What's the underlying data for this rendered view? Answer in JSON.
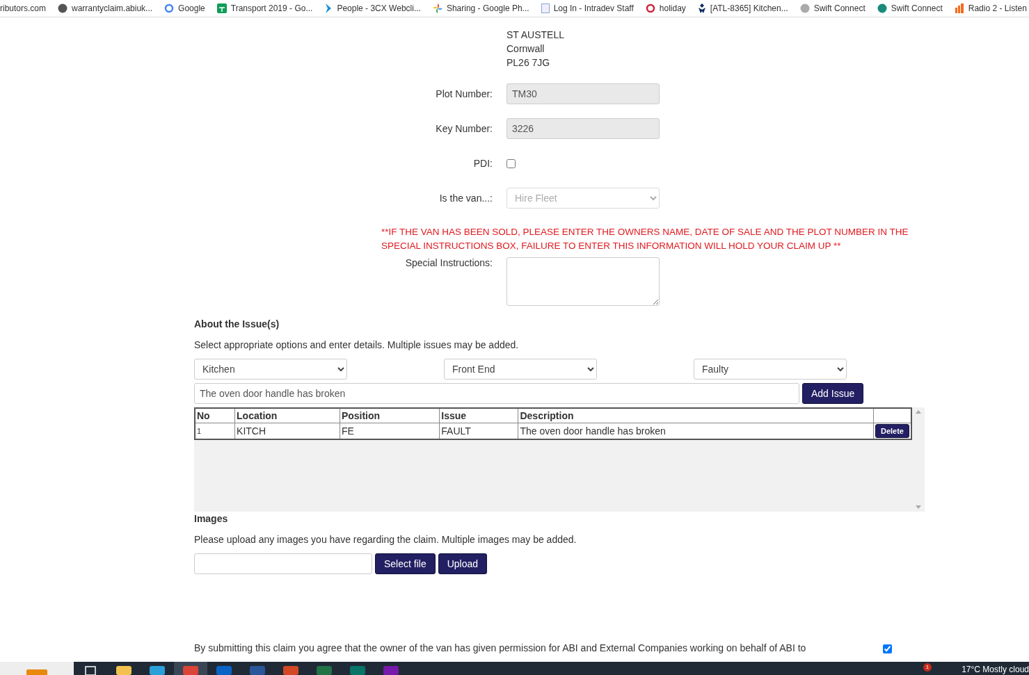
{
  "bookmarks": [
    {
      "kind": "none",
      "label": "ributors.com"
    },
    {
      "kind": "globe",
      "label": "warrantyclaim.abiuk..."
    },
    {
      "kind": "google",
      "label": "Google"
    },
    {
      "kind": "sheet",
      "label": "Transport 2019 - Go..."
    },
    {
      "kind": "chevron",
      "label": "People - 3CX Webcli..."
    },
    {
      "kind": "pinwheel",
      "label": "Sharing - Google Ph..."
    },
    {
      "kind": "doc",
      "label": "Log In - Intradev Staff"
    },
    {
      "kind": "ring",
      "label": "holiday"
    },
    {
      "kind": "figure",
      "label": "[ATL-8365] Kitchen..."
    },
    {
      "kind": "sphere",
      "label": "Swift Connect"
    },
    {
      "kind": "globe-teal",
      "label": "Swift Connect"
    },
    {
      "kind": "bars",
      "label": "Radio 2 - Listen"
    }
  ],
  "address": [
    "ST AUSTELL",
    "Cornwall",
    "PL26 7JG"
  ],
  "fields": [
    {
      "kind": "text",
      "label": "Plot Number:",
      "value": "TM30",
      "disabled": true
    },
    {
      "kind": "text",
      "label": "Key Number:",
      "value": "3226",
      "disabled": true
    },
    {
      "kind": "checkbox",
      "label": "PDI:",
      "checked": false
    },
    {
      "kind": "select",
      "label": "Is the van...:",
      "value": "Hire Fleet",
      "disabled": true
    }
  ],
  "warning": "**IF THE VAN HAS BEEN SOLD, PLEASE ENTER THE OWNERS NAME, DATE OF SALE AND THE PLOT NUMBER IN THE SPECIAL INSTRUCTIONS BOX, FAILURE TO ENTER THIS INFORMATION WILL HOLD YOUR CLAIM UP **",
  "special_instructions": {
    "label": "Special Instructions:"
  },
  "issues": {
    "heading": "About the Issue(s)",
    "text": "Select appropriate options and enter details. Multiple issues may be added.",
    "selects": [
      "Kitchen",
      "Front End",
      "Faulty"
    ],
    "description": "The oven door handle has broken",
    "add_button": "Add Issue",
    "table": {
      "columns": [
        "No",
        "Location",
        "Position",
        "Issue",
        "Description"
      ],
      "rows": [
        {
          "cells": [
            "1",
            "KITCH",
            "FE",
            "FAULT",
            "The oven door handle has broken"
          ],
          "action": "Delete"
        }
      ]
    }
  },
  "images": {
    "heading": "Images",
    "text": "Please upload any images you have regarding the claim. Multiple images may be added.",
    "select_button": "Select file",
    "upload_button": "Upload"
  },
  "consent": {
    "text": "By submitting this claim you agree that the owner of the van has given permission for ABI and External Companies working on behalf of ABI to",
    "checked": true
  },
  "taskbar": {
    "apps": [
      {
        "kind": "folder",
        "selected": false
      },
      {
        "kind": "edge",
        "selected": false
      },
      {
        "kind": "chrome",
        "selected": true
      },
      {
        "kind": "outlook",
        "selected": false
      },
      {
        "kind": "word",
        "selected": false
      },
      {
        "kind": "powerpoint",
        "selected": false
      },
      {
        "kind": "excel",
        "selected": false
      },
      {
        "kind": "publisher",
        "selected": false
      },
      {
        "kind": "onenote",
        "selected": false
      }
    ],
    "badge": "1",
    "weather": "17°C  Mostly cloud"
  }
}
